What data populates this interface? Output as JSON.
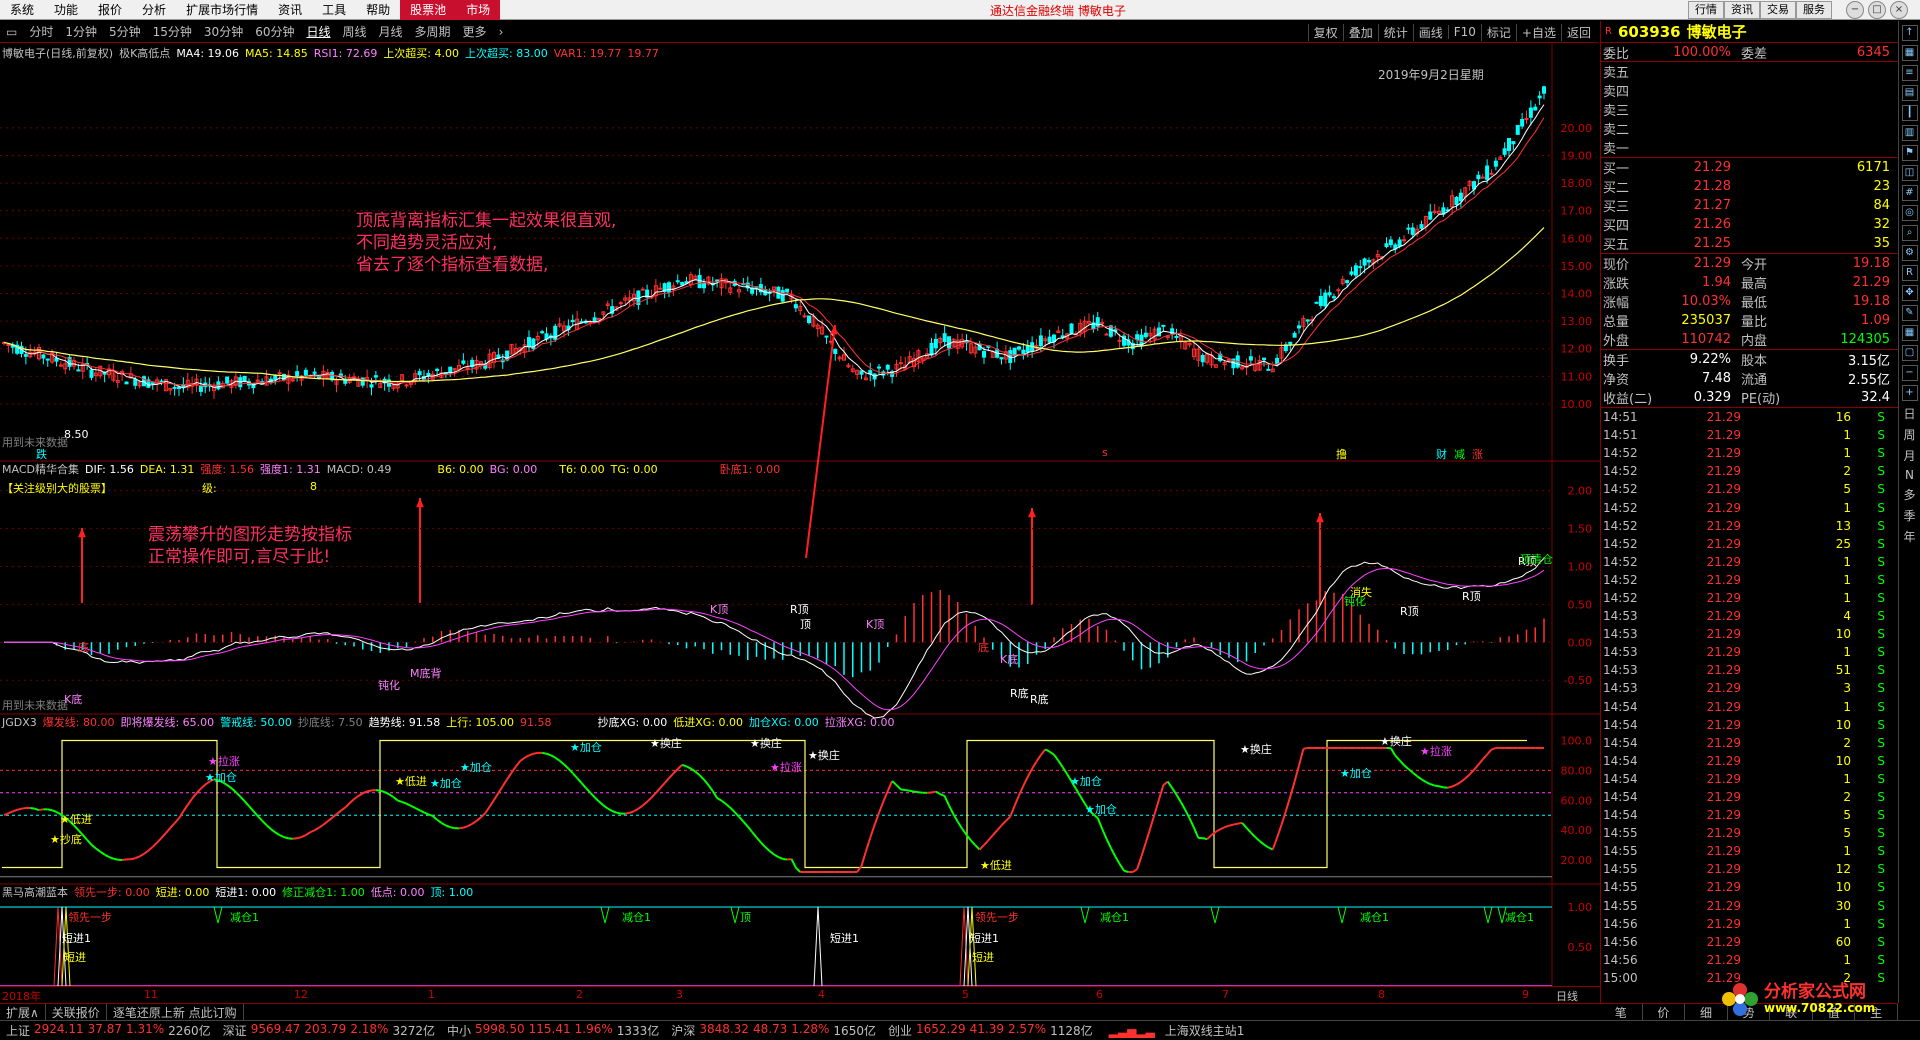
{
  "menubar": {
    "items": [
      "系统",
      "功能",
      "报价",
      "分析",
      "扩展市场行情",
      "资讯",
      "工具",
      "帮助"
    ],
    "highlight_items": [
      "股票池",
      "市场"
    ],
    "window_title": "通达信金融终端  博敏电子",
    "sys_buttons": [
      "行情",
      "资讯",
      "交易",
      "服务"
    ],
    "window_controls": [
      "−",
      "□",
      "×"
    ]
  },
  "toolbar": {
    "periods": [
      "分时",
      "1分钟",
      "5分钟",
      "15分钟",
      "30分钟",
      "60分钟",
      "日线",
      "周线",
      "月线",
      "多周期",
      "更多"
    ],
    "active": "日线",
    "right_items": [
      "复权",
      "叠加",
      "统计",
      "画线",
      "F10",
      "标记",
      "+自选",
      "返回"
    ]
  },
  "kline": {
    "header": {
      "name": "博敏电子(日线,前复权)",
      "indicator": "极K高低点",
      "ma4": "MA4: 19.06",
      "ma5": "MA5: 14.85",
      "rsi": "RSI1: 72.69",
      "last_buy": "上次超买: 4.00",
      "last_buy2": "上次超买: 83.00",
      "var1": "VAR1: 19.77",
      "var2": "19.77"
    },
    "date_label": "2019年9月2日星期",
    "low_label": "8.50",
    "future_note": "用到未来数据",
    "prices": [
      "20.00",
      "19.00",
      "18.00",
      "17.00",
      "16.00",
      "15.00",
      "14.00",
      "13.00",
      "12.00",
      "11.00",
      "10.00"
    ],
    "bottom_marks": [
      "跌",
      "s",
      "撸",
      "财",
      "减",
      "涨"
    ],
    "annotation": [
      "顶底背离指标汇集一起效果很直观,",
      "不同趋势灵活应对,",
      "省去了逐个指标查看数据,"
    ]
  },
  "macd": {
    "header": {
      "name": "MACD精华合集",
      "dif": "DIF: 1.56",
      "dea": "DEA: 1.31",
      "qd": "强度: 1.56",
      "rd": "强度1: 1.31",
      "macd": "MACD: 0.49",
      "b6": "B6: 0.00",
      "bg": "BG: 0.00",
      "t6": "T6: 0.00",
      "tg": "TG: 0.00",
      "dd": "卧底1: 0.00"
    },
    "focus": "【关注级别大的股票】",
    "level": "级:",
    "level_val": "8",
    "axis": [
      "2.00",
      "1.50",
      "1.00",
      "0.50",
      "0.00",
      "-0.50"
    ],
    "annotation": [
      "震荡攀升的图形走势按指标",
      "正常操作即可,言尽于此!"
    ],
    "future_note": "用到未来数据",
    "labels": [
      "底",
      "K底",
      "钝化",
      "M底背",
      "K顶",
      "R顶",
      "顶",
      "K顶",
      "底",
      "K底",
      "R底",
      "R底",
      "消失",
      "钝化",
      "R顶",
      "R顶",
      "R顶",
      "顶清仓"
    ]
  },
  "jgdx": {
    "header": {
      "name": "JGDX3",
      "a": "爆发线: 80.00",
      "b": "即将爆发线: 65.00",
      "c": "警戒线: 50.00",
      "d": "抄底线: 7.50",
      "e": "趋势线: 91.58",
      "f": "上行: 105.00",
      "g": "91.58",
      "h": "抄底XG: 0.00",
      "i": "低进XG: 0.00",
      "j": "加仓XG: 0.00",
      "k": "拉涨XG: 0.00"
    },
    "axis": [
      "100.0",
      "80.00",
      "60.00",
      "40.00",
      "20.00"
    ],
    "labels": [
      "低进",
      "抄底",
      "加仓",
      "拉涨",
      "低进",
      "加仓",
      "加仓",
      "加仓",
      "换庄",
      "换庄",
      "换庄",
      "拉涨",
      "低进",
      "加仓",
      "加仓",
      "换庄",
      "换庄",
      "拉涨",
      "加仓"
    ]
  },
  "heima": {
    "header": {
      "name": "黑马高潮蓝本",
      "a": "领先一步: 0.00",
      "b": "短进: 0.00",
      "c": "短进1: 0.00",
      "d": "修正减仓1: 1.00",
      "e": "低点: 0.00",
      "f": "顶: 1.00"
    },
    "axis": [
      "1.00",
      "0.50"
    ],
    "labels": [
      "领先一步",
      "短进1",
      "短进",
      "减仓1",
      "减仓1",
      "顶",
      "短进1",
      "领先一步",
      "短进1",
      "短进",
      "减仓1",
      "减仓1",
      "减仓1"
    ]
  },
  "timeline": {
    "labels": [
      "2018年",
      "11",
      "12",
      "1",
      "2",
      "3",
      "4",
      "5",
      "6",
      "7",
      "8",
      "9"
    ],
    "period": "日线"
  },
  "quote": {
    "code": "603936",
    "name": "博敏电子",
    "webi": "委比",
    "webi_val": "100.00%",
    "weicha": "委差",
    "weicha_val": "6345",
    "sells": [
      {
        "label": "卖五",
        "price": "",
        "vol": ""
      },
      {
        "label": "卖四",
        "price": "",
        "vol": ""
      },
      {
        "label": "卖三",
        "price": "",
        "vol": ""
      },
      {
        "label": "卖二",
        "price": "",
        "vol": ""
      },
      {
        "label": "卖一",
        "price": "",
        "vol": ""
      }
    ],
    "buys": [
      {
        "label": "买一",
        "price": "21.29",
        "vol": "6171"
      },
      {
        "label": "买二",
        "price": "21.28",
        "vol": "23"
      },
      {
        "label": "买三",
        "price": "21.27",
        "vol": "84"
      },
      {
        "label": "买四",
        "price": "21.26",
        "vol": "32"
      },
      {
        "label": "买五",
        "price": "21.25",
        "vol": "35"
      }
    ],
    "stats": [
      {
        "l1": "现价",
        "v1": "21.29",
        "c1": "#ff3030",
        "l2": "今开",
        "v2": "19.18",
        "c2": "#ff3030"
      },
      {
        "l1": "涨跌",
        "v1": "1.94",
        "c1": "#ff3030",
        "l2": "最高",
        "v2": "21.29",
        "c2": "#ff3030"
      },
      {
        "l1": "涨幅",
        "v1": "10.03%",
        "c1": "#ff3030",
        "l2": "最低",
        "v2": "19.18",
        "c2": "#ff3030"
      },
      {
        "l1": "总量",
        "v1": "235037",
        "c1": "#ffff00",
        "l2": "量比",
        "v2": "1.09",
        "c2": "#ff3030"
      },
      {
        "l1": "外盘",
        "v1": "110742",
        "c1": "#ff3030",
        "l2": "内盘",
        "v2": "124305",
        "c2": "#00ff00"
      }
    ],
    "stats2": [
      {
        "l1": "换手",
        "v1": "9.22%",
        "l2": "股本",
        "v2": "3.15亿"
      },
      {
        "l1": "净资",
        "v1": "7.48",
        "l2": "流通",
        "v2": "2.55亿"
      },
      {
        "l1": "收益(二)",
        "v1": "0.329",
        "l2": "PE(动)",
        "v2": "32.4"
      }
    ],
    "ticks": [
      {
        "t": "14:51",
        "p": "21.29",
        "v": "16",
        "s": "S"
      },
      {
        "t": "14:51",
        "p": "21.29",
        "v": "1",
        "s": "S"
      },
      {
        "t": "14:52",
        "p": "21.29",
        "v": "1",
        "s": "S"
      },
      {
        "t": "14:52",
        "p": "21.29",
        "v": "2",
        "s": "S"
      },
      {
        "t": "14:52",
        "p": "21.29",
        "v": "5",
        "s": "S"
      },
      {
        "t": "14:52",
        "p": "21.29",
        "v": "1",
        "s": "S"
      },
      {
        "t": "14:52",
        "p": "21.29",
        "v": "13",
        "s": "S"
      },
      {
        "t": "14:52",
        "p": "21.29",
        "v": "25",
        "s": "S"
      },
      {
        "t": "14:52",
        "p": "21.29",
        "v": "1",
        "s": "S"
      },
      {
        "t": "14:52",
        "p": "21.29",
        "v": "1",
        "s": "S"
      },
      {
        "t": "14:52",
        "p": "21.29",
        "v": "1",
        "s": "S"
      },
      {
        "t": "14:53",
        "p": "21.29",
        "v": "4",
        "s": "S"
      },
      {
        "t": "14:53",
        "p": "21.29",
        "v": "10",
        "s": "S"
      },
      {
        "t": "14:53",
        "p": "21.29",
        "v": "1",
        "s": "S"
      },
      {
        "t": "14:53",
        "p": "21.29",
        "v": "51",
        "s": "S"
      },
      {
        "t": "14:53",
        "p": "21.29",
        "v": "3",
        "s": "S"
      },
      {
        "t": "14:54",
        "p": "21.29",
        "v": "1",
        "s": "S"
      },
      {
        "t": "14:54",
        "p": "21.29",
        "v": "10",
        "s": "S"
      },
      {
        "t": "14:54",
        "p": "21.29",
        "v": "2",
        "s": "S"
      },
      {
        "t": "14:54",
        "p": "21.29",
        "v": "10",
        "s": "S"
      },
      {
        "t": "14:54",
        "p": "21.29",
        "v": "1",
        "s": "S"
      },
      {
        "t": "14:54",
        "p": "21.29",
        "v": "2",
        "s": "S"
      },
      {
        "t": "14:54",
        "p": "21.29",
        "v": "5",
        "s": "S"
      },
      {
        "t": "14:55",
        "p": "21.29",
        "v": "5",
        "s": "S"
      },
      {
        "t": "14:55",
        "p": "21.29",
        "v": "1",
        "s": "S"
      },
      {
        "t": "14:55",
        "p": "21.29",
        "v": "12",
        "s": "S"
      },
      {
        "t": "14:55",
        "p": "21.29",
        "v": "10",
        "s": "S"
      },
      {
        "t": "14:55",
        "p": "21.29",
        "v": "30",
        "s": "S"
      },
      {
        "t": "14:56",
        "p": "21.29",
        "v": "1",
        "s": "S"
      },
      {
        "t": "14:56",
        "p": "21.29",
        "v": "60",
        "s": "S"
      },
      {
        "t": "14:56",
        "p": "21.29",
        "v": "1",
        "s": "S"
      },
      {
        "t": "15:00",
        "p": "21.29",
        "v": "2",
        "s": "S"
      }
    ],
    "bottom_tabs": [
      "笔",
      "价",
      "细",
      "势",
      "联",
      "值",
      "主"
    ]
  },
  "side_toolbar": {
    "icons": [
      "arrow-up-icon",
      "grid-icon",
      "list-icon",
      "chart-icon",
      "ruler-icon",
      "bar-icon",
      "flag-icon",
      "chart2-icon",
      "hash-icon",
      "target-icon",
      "zoom-icon",
      "gear-icon",
      "rsi-icon",
      "move-icon",
      "pen-icon",
      "table-icon",
      "box-icon",
      "minus-icon",
      "plus-icon"
    ],
    "texts": [
      "日",
      "周",
      "月",
      "N",
      "多",
      "季",
      "年"
    ]
  },
  "bottom_tabs": [
    "扩展∧",
    "关联报价",
    "逐笔还原上新 点此订购"
  ],
  "statusbar": [
    {
      "name": "上证",
      "a": "2924.11",
      "b": "37.87",
      "c": "1.31%",
      "d": "2260亿"
    },
    {
      "name": "深证",
      "a": "9569.47",
      "b": "203.79",
      "c": "2.18%",
      "d": "3272亿"
    },
    {
      "name": "中小",
      "a": "5998.50",
      "b": "115.41",
      "c": "1.96%",
      "d": "1333亿"
    },
    {
      "name": "沪深",
      "a": "3848.32",
      "b": "48.73",
      "c": "1.28%",
      "d": "1650亿"
    },
    {
      "name": "创业",
      "a": "1652.29",
      "b": "41.39",
      "c": "2.57%",
      "d": "1128亿"
    }
  ],
  "station": "上海双线主站1",
  "logo": {
    "name": "分析家公式网",
    "url": "www.70822.com"
  },
  "colors": {
    "up": "#ff3030",
    "down": "#00ffff",
    "ma_yellow": "#ffff66",
    "ma_white": "#ffffff",
    "grid": "#800000"
  }
}
